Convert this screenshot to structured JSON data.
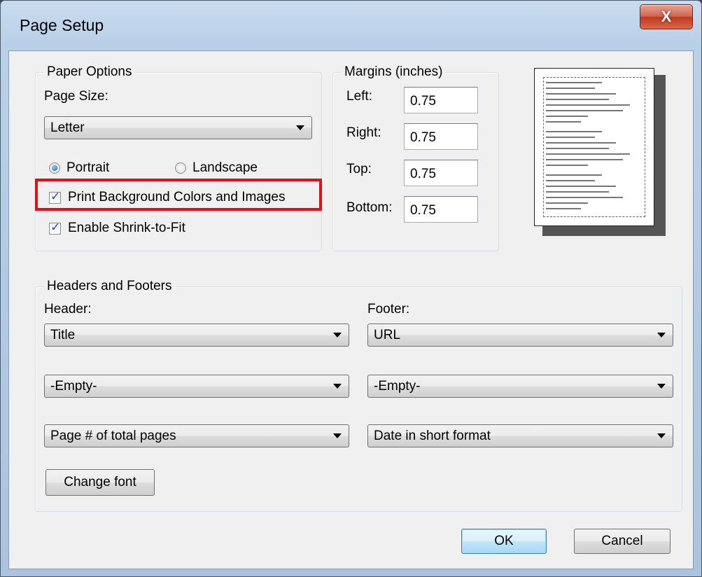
{
  "window": {
    "title": "Page Setup",
    "close_label": "X"
  },
  "paper_options": {
    "legend": "Paper Options",
    "page_size_label": "Page Size:",
    "page_size_value": "Letter",
    "portrait_label": "Portrait",
    "landscape_label": "Landscape",
    "orientation_selected": "Portrait",
    "print_background_label": "Print Background Colors and Images",
    "print_background_checked": true,
    "shrink_to_fit_label": "Enable Shrink-to-Fit",
    "shrink_to_fit_checked": true
  },
  "margins": {
    "legend": "Margins (inches)",
    "left_label": "Left:",
    "left_value": "0.75",
    "right_label": "Right:",
    "right_value": "0.75",
    "top_label": "Top:",
    "top_value": "0.75",
    "bottom_label": "Bottom:",
    "bottom_value": "0.75"
  },
  "headers_footers": {
    "legend": "Headers and Footers",
    "header_label": "Header:",
    "footer_label": "Footer:",
    "header_1": "Title",
    "header_2": "-Empty-",
    "header_3": "Page # of total pages",
    "footer_1": "URL",
    "footer_2": "-Empty-",
    "footer_3": "Date in short format",
    "change_font_label": "Change font"
  },
  "buttons": {
    "ok_label": "OK",
    "cancel_label": "Cancel"
  },
  "colors": {
    "highlight": "#e80c15",
    "accent": "#3c7fb1",
    "close_red": "#c0391e"
  }
}
